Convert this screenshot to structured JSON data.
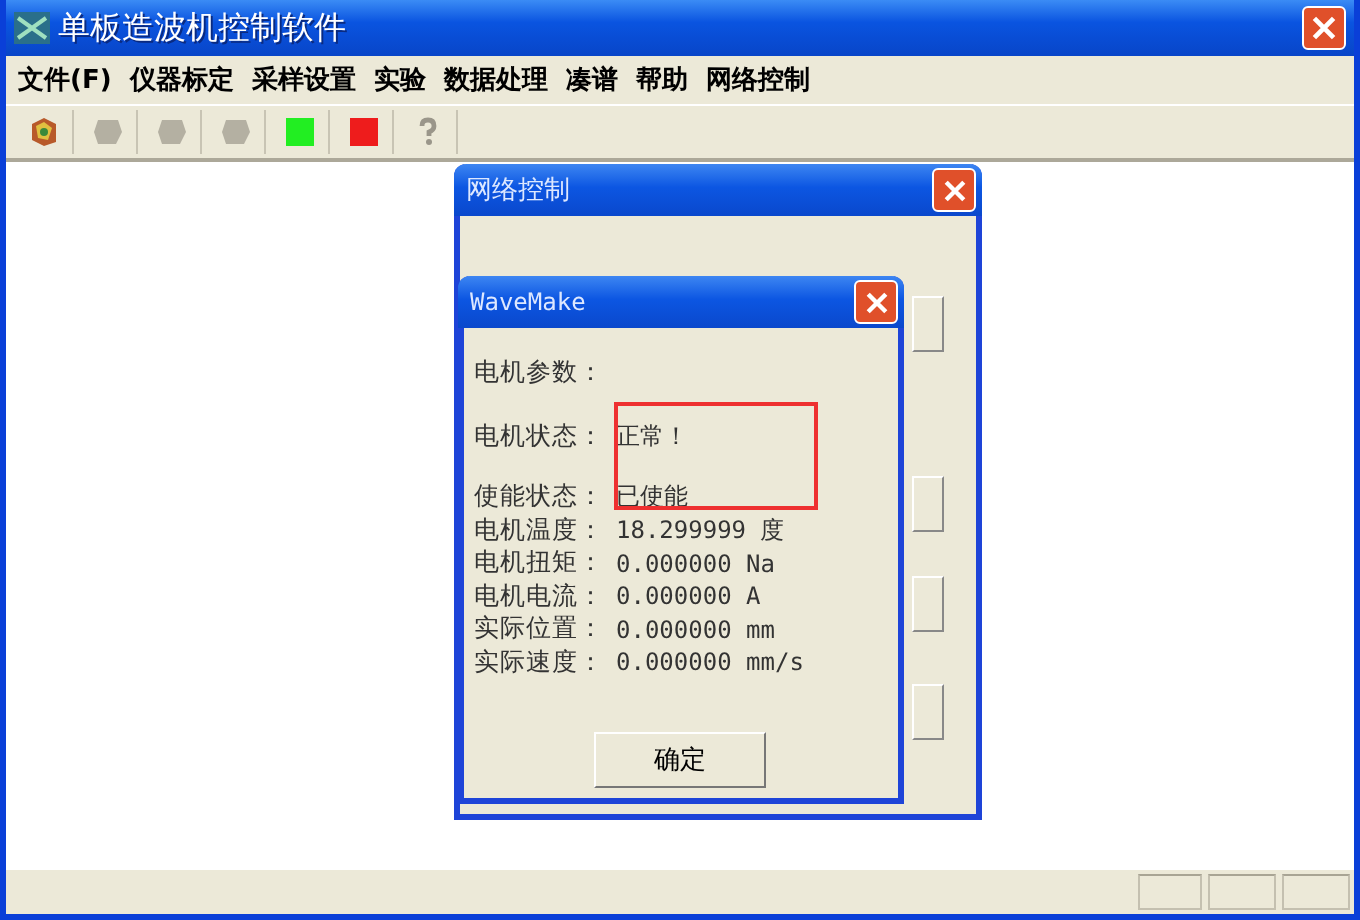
{
  "window": {
    "title": "单板造波机控制软件"
  },
  "menu": [
    "文件(F)",
    "仪器标定",
    "采样设置",
    "实验",
    "数据处理",
    "凑谱",
    "帮助",
    "网络控制"
  ],
  "toolbar": [
    {
      "kind": "app"
    },
    {
      "kind": "blank"
    },
    {
      "kind": "blank"
    },
    {
      "kind": "blank"
    },
    {
      "kind": "green"
    },
    {
      "kind": "red"
    },
    {
      "kind": "help"
    }
  ],
  "back_dialog": {
    "title": "网络控制"
  },
  "dialog": {
    "title": "WaveMake",
    "section_label": "电机参数：",
    "rows": [
      {
        "kind": "status",
        "label": "电机状态：",
        "value": "正常！"
      },
      {
        "kind": "status",
        "label": "使能状态：",
        "value": "已使能"
      },
      {
        "kind": "reading",
        "label": "电机温度：",
        "value": "18.299999 度"
      },
      {
        "kind": "reading",
        "label": "电机扭矩：",
        "value": "0.000000 Na"
      },
      {
        "kind": "reading",
        "label": "电机电流：",
        "value": "0.000000 A"
      },
      {
        "kind": "reading",
        "label": "实际位置：",
        "value": "0.000000 mm"
      },
      {
        "kind": "reading",
        "label": "实际速度：",
        "value": "0.000000 mm/s"
      }
    ],
    "button": "确定"
  }
}
